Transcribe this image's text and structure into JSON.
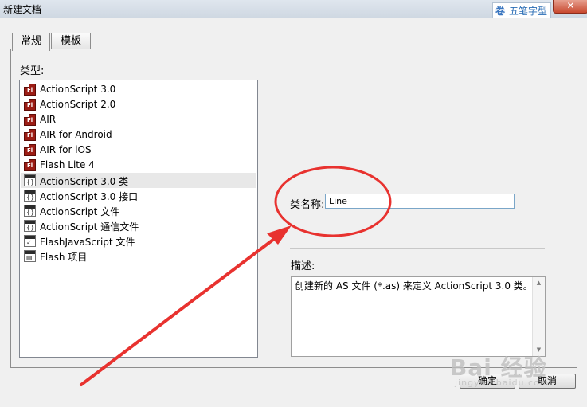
{
  "window": {
    "title": "新建文档",
    "close_label": "✕"
  },
  "logo": {
    "text": "五笔字型",
    "glyph": "卷"
  },
  "tabs": [
    {
      "label": "常规",
      "active": true
    },
    {
      "label": "模板",
      "active": false
    }
  ],
  "type_section": {
    "label": "类型:"
  },
  "type_list": [
    {
      "label": "ActionScript 3.0",
      "icon": "flash-file-icon"
    },
    {
      "label": "ActionScript 2.0",
      "icon": "flash-file-icon"
    },
    {
      "label": "AIR",
      "icon": "flash-file-icon"
    },
    {
      "label": "AIR for Android",
      "icon": "flash-file-icon"
    },
    {
      "label": "AIR for iOS",
      "icon": "flash-file-icon"
    },
    {
      "label": "Flash Lite 4",
      "icon": "flash-file-icon"
    },
    {
      "label": "ActionScript 3.0 类",
      "icon": "script-file-icon",
      "selected": true
    },
    {
      "label": "ActionScript 3.0 接口",
      "icon": "script-file-icon"
    },
    {
      "label": "ActionScript 文件",
      "icon": "script-file-icon"
    },
    {
      "label": "ActionScript 通信文件",
      "icon": "script-file-icon"
    },
    {
      "label": "FlashJavaScript 文件",
      "icon": "script-file-icon"
    },
    {
      "label": "Flash 项目",
      "icon": "project-file-icon"
    }
  ],
  "class_name": {
    "label": "类名称:",
    "value": "Line"
  },
  "description": {
    "label": "描述:",
    "text": "创建新的 AS 文件 (*.as) 来定义 ActionScript 3.0 类。"
  },
  "buttons": {
    "ok": "确定",
    "cancel": "取消"
  },
  "watermark": {
    "main": "Bai 经验",
    "sub": "jingyan.baidu.com"
  },
  "annotation_color": "#e8322f"
}
